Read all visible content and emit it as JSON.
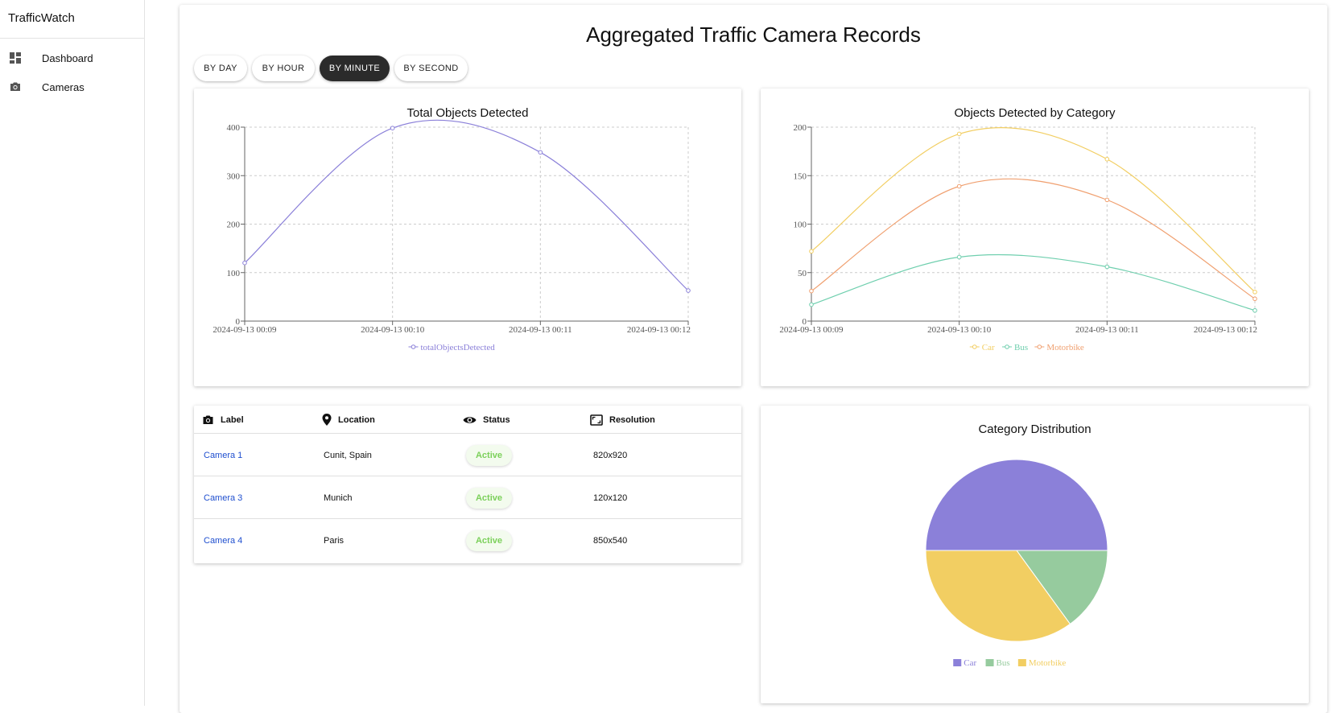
{
  "app": {
    "title": "TrafficWatch"
  },
  "sidebar": {
    "items": [
      {
        "label": "Dashboard",
        "icon": "dashboard-icon"
      },
      {
        "label": "Cameras",
        "icon": "camera-icon"
      }
    ]
  },
  "page": {
    "title": "Aggregated Traffic Camera Records"
  },
  "filters": {
    "buttons": [
      {
        "label": "BY DAY",
        "active": false
      },
      {
        "label": "BY HOUR",
        "active": false
      },
      {
        "label": "BY MINUTE",
        "active": true
      },
      {
        "label": "BY SECOND",
        "active": false
      }
    ]
  },
  "colors": {
    "purple": "#8b80d9",
    "yellow": "#f2ce62",
    "green": "#6fcfae",
    "orange": "#f0a070",
    "pieGreen": "#96cb9e",
    "link": "#1f4fcf",
    "active": "#7bd05a"
  },
  "chart_data": [
    {
      "type": "line",
      "title": "Total Objects Detected",
      "x": [
        "2024-09-13 00:09",
        "2024-09-13 00:10",
        "2024-09-13 00:11",
        "2024-09-13 00:12"
      ],
      "series": [
        {
          "name": "totalObjectsDetected",
          "values": [
            120,
            398,
            348,
            63
          ],
          "color": "#8b80d9"
        }
      ],
      "ylim": [
        0,
        400
      ],
      "yticks": [
        0,
        100,
        200,
        300,
        400
      ],
      "grid": true,
      "legend": "bottom"
    },
    {
      "type": "line",
      "title": "Objects Detected by Category",
      "x": [
        "2024-09-13 00:09",
        "2024-09-13 00:10",
        "2024-09-13 00:11",
        "2024-09-13 00:12"
      ],
      "series": [
        {
          "name": "Car",
          "values": [
            72,
            193,
            167,
            30
          ],
          "color": "#f2ce62"
        },
        {
          "name": "Bus",
          "values": [
            17,
            66,
            56,
            11
          ],
          "color": "#6fcfae"
        },
        {
          "name": "Motorbike",
          "values": [
            31,
            139,
            125,
            23
          ],
          "color": "#f0a070"
        }
      ],
      "ylim": [
        0,
        200
      ],
      "yticks": [
        0,
        50,
        100,
        150,
        200
      ],
      "grid": true,
      "legend": "bottom"
    },
    {
      "type": "pie",
      "title": "Category Distribution",
      "categories": [
        "Car",
        "Bus",
        "Motorbike"
      ],
      "values": [
        50,
        15,
        35
      ],
      "colors": [
        "#8b80d9",
        "#96cb9e",
        "#f2ce62"
      ],
      "legend": "bottom"
    }
  ],
  "table": {
    "headers": [
      {
        "label": "Label",
        "icon": "camera-icon"
      },
      {
        "label": "Location",
        "icon": "location-pin-icon"
      },
      {
        "label": "Status",
        "icon": "eye-icon"
      },
      {
        "label": "Resolution",
        "icon": "aspect-ratio-icon"
      }
    ],
    "rows": [
      {
        "label": "Camera 1",
        "location": "Cunit, Spain",
        "status": "Active",
        "resolution": "820x920"
      },
      {
        "label": "Camera 3",
        "location": "Munich",
        "status": "Active",
        "resolution": "120x120"
      },
      {
        "label": "Camera 4",
        "location": "Paris",
        "status": "Active",
        "resolution": "850x540"
      }
    ]
  }
}
